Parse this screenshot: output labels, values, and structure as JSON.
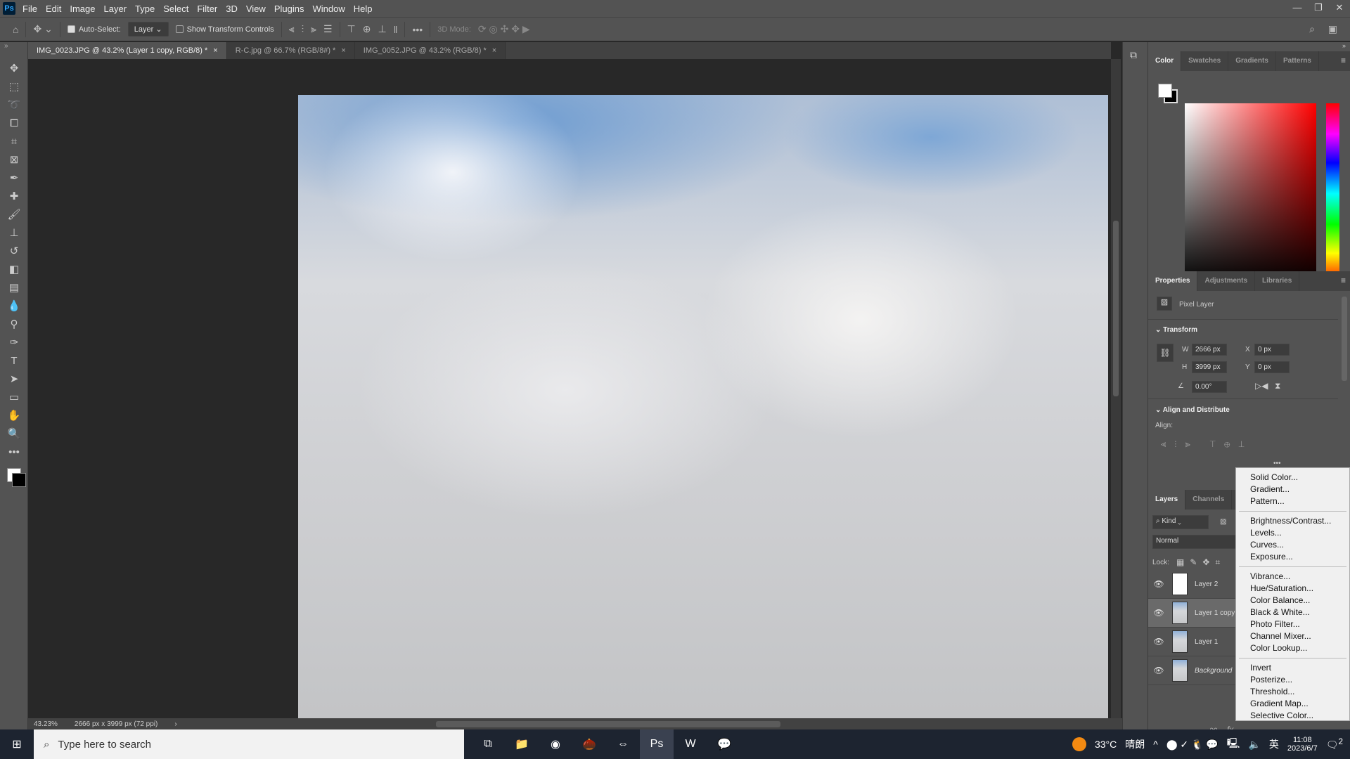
{
  "app": {
    "logo": "Ps",
    "menu": [
      "File",
      "Edit",
      "Image",
      "Layer",
      "Type",
      "Select",
      "Filter",
      "3D",
      "View",
      "Plugins",
      "Window",
      "Help"
    ],
    "window_controls": [
      "minimize",
      "restore",
      "close"
    ]
  },
  "options": {
    "auto_select_label": "Auto-Select:",
    "auto_select_checked": true,
    "auto_select_target": "Layer",
    "show_transform_label": "Show Transform Controls",
    "show_transform_checked": false,
    "more": "•••",
    "mode_3d_label": "3D Mode:"
  },
  "tabs": [
    {
      "label": "IMG_0023.JPG @ 43.2% (Layer 1 copy, RGB/8) *",
      "active": true
    },
    {
      "label": "R-C.jpg @ 66.7% (RGB/8#) *",
      "active": false
    },
    {
      "label": "IMG_0052.JPG @ 43.2% (RGB/8) *",
      "active": false
    }
  ],
  "tools": [
    "move",
    "marquee",
    "lasso",
    "object-select",
    "crop",
    "frame",
    "eyedropper",
    "healing",
    "brush",
    "stamp",
    "history-brush",
    "eraser",
    "gradient",
    "blur",
    "dodge",
    "pen",
    "type",
    "path-select",
    "rectangle",
    "hand",
    "zoom",
    "more"
  ],
  "status": {
    "zoom": "43.23%",
    "doc_info": "2666 px x 3999 px (72 ppi)"
  },
  "color_panel": {
    "tabs": [
      "Color",
      "Swatches",
      "Gradients",
      "Patterns"
    ],
    "active": "Color",
    "foreground": "#ffffff",
    "background": "#000000",
    "hue": "#ff0000"
  },
  "properties": {
    "tabs": [
      "Properties",
      "Adjustments",
      "Libraries"
    ],
    "active": "Properties",
    "layer_type": "Pixel Layer",
    "transform_title": "Transform",
    "w_label": "W",
    "w": "2666 px",
    "h_label": "H",
    "h": "3999 px",
    "x_label": "X",
    "x": "0 px",
    "y_label": "Y",
    "y": "0 px",
    "angle": "0.00°",
    "align_title": "Align and Distribute",
    "align_label": "Align:",
    "more": "•••"
  },
  "layers_panel": {
    "tabs": [
      "Layers",
      "Channels",
      "P"
    ],
    "active": "Layers",
    "filter": "Kind",
    "blend": "Normal",
    "lock_label": "Lock:",
    "layers": [
      {
        "name": "Layer 2",
        "selected": false
      },
      {
        "name": "Layer 1 copy",
        "selected": true
      },
      {
        "name": "Layer 1",
        "selected": false
      },
      {
        "name": "Background",
        "selected": false
      }
    ]
  },
  "adjustment_menu": [
    [
      "Solid Color...",
      "Gradient...",
      "Pattern..."
    ],
    [
      "Brightness/Contrast...",
      "Levels...",
      "Curves...",
      "Exposure..."
    ],
    [
      "Vibrance...",
      "Hue/Saturation...",
      "Color Balance...",
      "Black & White...",
      "Photo Filter...",
      "Channel Mixer...",
      "Color Lookup..."
    ],
    [
      "Invert",
      "Posterize...",
      "Threshold...",
      "Gradient Map...",
      "Selective Color..."
    ]
  ],
  "taskbar": {
    "search_placeholder": "Type here to search",
    "apps": [
      "task-view",
      "file-explorer",
      "chrome",
      "acorn",
      "teamviewer",
      "photoshop",
      "word",
      "wechat"
    ],
    "weather": "33°C",
    "weather_desc": "晴朗",
    "ime": "英",
    "time": "11:08",
    "date": "2023/6/7",
    "notifications": "2"
  }
}
